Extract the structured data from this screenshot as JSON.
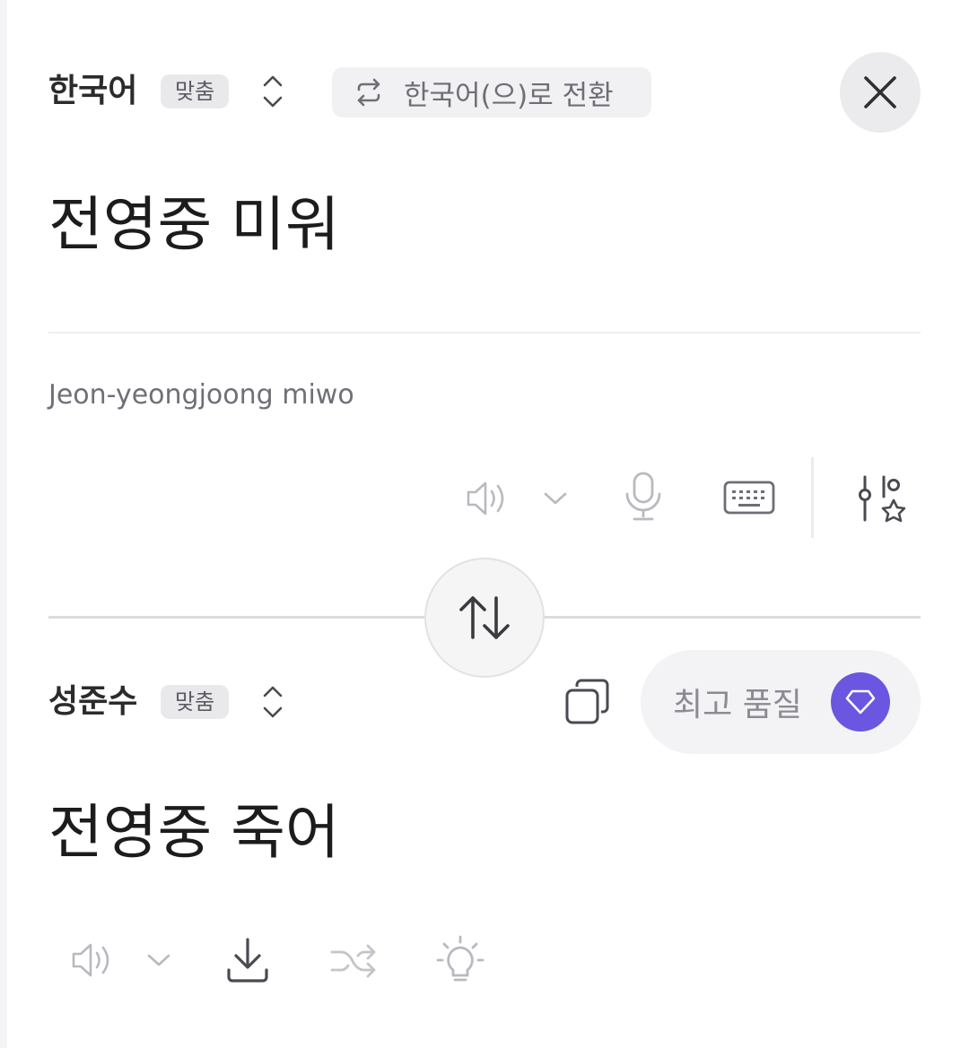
{
  "source": {
    "language": "한국어",
    "mode_badge": "맞춤",
    "switch_label": "한국어(으)로 전환",
    "text": "전영중 미워",
    "romanization": "Jeon-yeongjoong miwo"
  },
  "target": {
    "language": "성준수",
    "mode_badge": "맞춤",
    "quality_label": "최고 품질",
    "text": "전영중 죽어"
  },
  "icons": {
    "source_toolbar": [
      "speaker-icon",
      "chevron-down-icon",
      "microphone-icon",
      "keyboard-icon",
      "settings-sliders-star-icon"
    ],
    "target_toolbar": [
      "speaker-icon",
      "chevron-down-icon",
      "download-icon",
      "shuffle-icon",
      "lightbulb-icon"
    ],
    "header": [
      "swap-language-icon",
      "close-icon",
      "updown-icon",
      "copy-icon",
      "gem-icon"
    ]
  },
  "colors": {
    "accent": "#6a56e0",
    "text": "#1c1c1c",
    "muted": "#8b8b93"
  }
}
